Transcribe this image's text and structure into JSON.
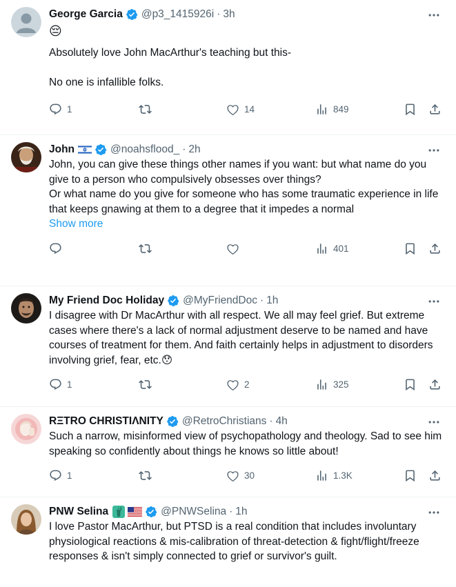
{
  "tweets": [
    {
      "name": "George Garcia",
      "handle": "@p3_1415926i",
      "time": "3h",
      "text": "Absolutely love John MacArthur's teaching but this-\n\nNo one is infallible folks.",
      "emoji_line": "😔",
      "replies": "1",
      "reposts": "",
      "likes": "14",
      "views": "849"
    },
    {
      "name": "John",
      "flag_emoji": "🇮🇱",
      "handle": "@noahsflood_",
      "time": "2h",
      "text": "John, you can give these things other names if you want: but what name do you give to a person who compulsively obsesses over things?\nOr what name do you give for someone who has some traumatic experience in life that keeps gnawing at them to a degree that it impedes a normal",
      "show_more": "Show more",
      "replies": "",
      "reposts": "",
      "likes": "",
      "views": "401"
    },
    {
      "name": "My Friend Doc Holiday",
      "handle": "@MyFriendDoc",
      "time": "1h",
      "text": "I disagree with Dr MacArthur with all respect. We all may feel grief. But extreme cases where there's a lack of normal adjustment deserve to be named and have courses of treatment for them. And faith certainly helps in adjustment to disorders involving grief, fear, etc.",
      "text_emoji": "😯",
      "replies": "1",
      "reposts": "",
      "likes": "2",
      "views": "325"
    },
    {
      "name": "RΞTRO CHRISTIΛNITY",
      "handle": "@RetroChristians",
      "time": "4h",
      "text": "Such a narrow, misinformed view of psychopathology and theology. Sad to see him speaking so confidently about things he knows so little about!",
      "replies": "1",
      "reposts": "",
      "likes": "30",
      "views": "1.3K"
    },
    {
      "name": "PNW Selina",
      "flag_emoji": "🗽🇺🇸",
      "handle": "@PNWSelina",
      "time": "1h",
      "text": "I love Pastor MacArthur, but PTSD is a real condition that includes involuntary physiological reactions & mis-calibration of threat-detection & fight/flight/freeze responses & isn't simply connected to grief or survivor's guilt."
    }
  ],
  "colors": {
    "verified": "#1d9bf0",
    "secondary_text": "#536471",
    "link": "#1d9bf0",
    "divider": "#eff3f4"
  },
  "icons": [
    "more-icon",
    "reply-icon",
    "repost-icon",
    "like-icon",
    "views-icon",
    "bookmark-icon",
    "share-icon",
    "verified-badge-icon"
  ]
}
